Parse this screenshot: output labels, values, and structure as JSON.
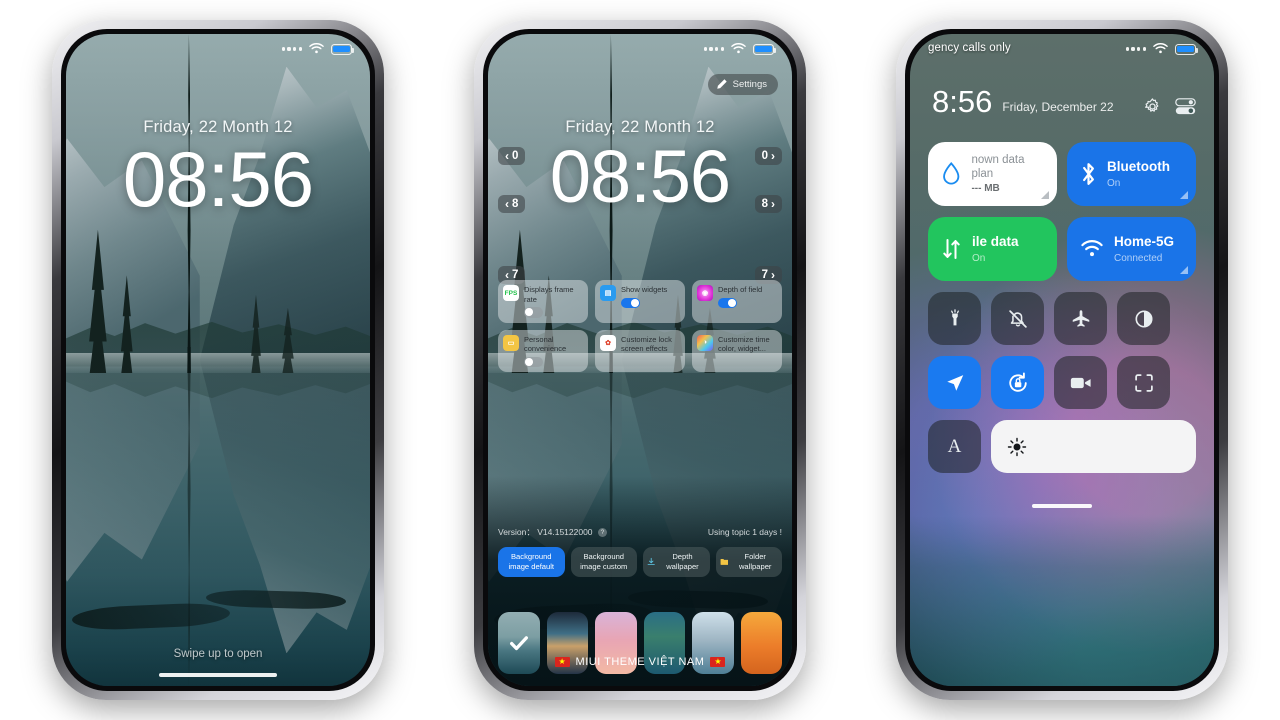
{
  "page": {
    "background_color": "#ffffff"
  },
  "phone1": {
    "name": "lock-screen-preview",
    "status_bar": {
      "signal": "....",
      "wifi": "wifi-icon",
      "battery": "battery-icon",
      "battery_color": "#1f8fff"
    },
    "lock": {
      "date": "Friday, 22 Month 12",
      "time": "08:56"
    },
    "swipe_hint": "Swipe up to open"
  },
  "phone2": {
    "name": "lock-screen-editor",
    "status_bar": {
      "signal": "....",
      "wifi": "wifi-icon",
      "battery": "battery-icon"
    },
    "settings_button": {
      "label": "Settings",
      "icon": "pencil-icon"
    },
    "lock": {
      "date": "Friday, 22 Month 12",
      "time": "08:56"
    },
    "side_badges_left": [
      "0",
      "8",
      "7"
    ],
    "side_badges_right": [
      "0",
      "8",
      "7"
    ],
    "tiles": [
      {
        "label": "Displays frame rate",
        "icon": "fps-icon",
        "icon_color": "#f0f2f3",
        "toggle": "off"
      },
      {
        "label": "Show widgets",
        "icon": "widgets-icon",
        "icon_color": "#2a9bf0",
        "toggle": "on"
      },
      {
        "label": "Depth of field",
        "icon": "depth-icon",
        "icon_color": "#e033d8",
        "toggle": "on"
      },
      {
        "label": "Personal convenience",
        "icon": "wallet-icon",
        "icon_color": "#f0c killer",
        "toggle": "off"
      },
      {
        "label": "Customize lock screen effects",
        "icon": "effects-icon",
        "icon_color": "#ffffff",
        "toggle": "none"
      },
      {
        "label": "Customize time color, widget...",
        "icon": "palette-icon",
        "icon_color": "#2d2d2f",
        "toggle": "none"
      }
    ],
    "info": {
      "version_label": "Version：",
      "version_value": "V14.15122000",
      "help": "?",
      "usage": "Using topic 1 days !"
    },
    "tabs": [
      {
        "label": "Background image default",
        "selected": true,
        "icon": "none"
      },
      {
        "label": "Background image custom",
        "selected": false,
        "icon": "none"
      },
      {
        "label": "Depth wallpaper",
        "selected": false,
        "icon": "download-icon"
      },
      {
        "label": "Folder wallpaper",
        "selected": false,
        "icon": "folder-icon"
      }
    ],
    "thumbnails": [
      {
        "name": "lake-mirror-wallpaper",
        "selected": true
      },
      {
        "name": "cabin-island-wallpaper",
        "selected": false
      },
      {
        "name": "palm-sunset-wallpaper",
        "selected": false
      },
      {
        "name": "catalina-coast-wallpaper",
        "selected": false
      },
      {
        "name": "cliff-sea-wallpaper",
        "selected": false
      },
      {
        "name": "orange-abstract-wallpaper",
        "selected": false
      }
    ],
    "footer": {
      "text": "MIUI THEME VIỆT NAM",
      "flag": "vietnam-flag"
    }
  },
  "phone3": {
    "name": "control-center",
    "status_bar": {
      "carrier": "gency calls only",
      "signal": "....",
      "wifi": "wifi-icon",
      "battery": "battery-icon"
    },
    "header": {
      "time": "8:56",
      "date": "Friday, December 22",
      "gear": "gear-icon",
      "edit": "edit-toggles-icon"
    },
    "big_tiles": [
      {
        "title": "nown data plan",
        "subtitle": "--- MB",
        "icon": "data-drop-icon",
        "bg": "#ffffff",
        "fg": "#6d7378",
        "accent": "#1a8cf0"
      },
      {
        "title": "Bluetooth",
        "subtitle": "On",
        "icon": "bluetooth-icon",
        "bg": "#1a74e8",
        "fg": "#ffffff"
      },
      {
        "title": "ile data",
        "subtitle": "On",
        "icon": "mobile-data-icon",
        "bg": "#22c55e",
        "fg": "#ffffff"
      },
      {
        "title": "Home-5G",
        "subtitle": "Connected",
        "icon": "wifi-icon",
        "bg": "#1a74e8",
        "fg": "#ffffff"
      }
    ],
    "quick_toggles": [
      {
        "name": "flashlight-icon",
        "active": false
      },
      {
        "name": "mute-icon",
        "active": false
      },
      {
        "name": "airplane-icon",
        "active": false
      },
      {
        "name": "dark-mode-icon",
        "active": false
      },
      {
        "name": "location-icon",
        "active": true
      },
      {
        "name": "rotation-lock-icon",
        "active": true
      },
      {
        "name": "screen-recorder-icon",
        "active": false
      },
      {
        "name": "scanner-icon",
        "active": false
      },
      {
        "name": "auto-brightness-icon",
        "active": false
      }
    ],
    "brightness": {
      "icon": "sun-icon",
      "level": 100
    }
  }
}
